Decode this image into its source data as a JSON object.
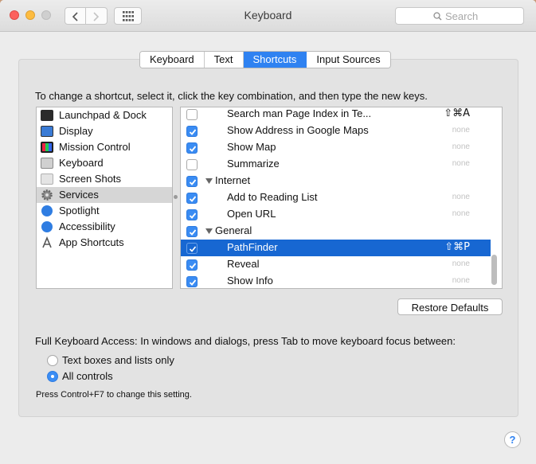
{
  "window": {
    "title": "Keyboard",
    "search_placeholder": "Search"
  },
  "tabs": [
    {
      "label": "Keyboard",
      "active": false
    },
    {
      "label": "Text",
      "active": false
    },
    {
      "label": "Shortcuts",
      "active": true
    },
    {
      "label": "Input Sources",
      "active": false
    }
  ],
  "instructions": "To change a shortcut, select it, click the key combination, and then type the new keys.",
  "categories": [
    {
      "label": "Launchpad & Dock",
      "icon": "launchpad-icon",
      "color": "#2b2b2b"
    },
    {
      "label": "Display",
      "icon": "display-icon",
      "color": "#3a7bd5"
    },
    {
      "label": "Mission Control",
      "icon": "mission-control-icon",
      "color": "#1f1f1f"
    },
    {
      "label": "Keyboard",
      "icon": "keyboard-icon",
      "color": "#8a8a8a"
    },
    {
      "label": "Screen Shots",
      "icon": "screenshot-icon",
      "color": "#b0b0b0"
    },
    {
      "label": "Services",
      "icon": "gear-icon",
      "color": "#7a7a7a",
      "selected": true
    },
    {
      "label": "Spotlight",
      "icon": "spotlight-icon",
      "color": "#2f7de2"
    },
    {
      "label": "Accessibility",
      "icon": "accessibility-icon",
      "color": "#2f7de2"
    },
    {
      "label": "App Shortcuts",
      "icon": "app-shortcuts-icon",
      "color": "#555555"
    }
  ],
  "shortcuts": [
    {
      "type": "item",
      "label": "Search man Page Index in Te...",
      "checked": false,
      "key": "⇧⌘A"
    },
    {
      "type": "item",
      "label": "Show Address in Google Maps",
      "checked": true,
      "key": "none"
    },
    {
      "type": "item",
      "label": "Show Map",
      "checked": true,
      "key": "none"
    },
    {
      "type": "item",
      "label": "Summarize",
      "checked": false,
      "key": "none"
    },
    {
      "type": "group",
      "label": "Internet",
      "checked": true
    },
    {
      "type": "item",
      "label": "Add to Reading List",
      "checked": true,
      "key": "none"
    },
    {
      "type": "item",
      "label": "Open URL",
      "checked": true,
      "key": "none"
    },
    {
      "type": "group",
      "label": "General",
      "checked": true
    },
    {
      "type": "item",
      "label": "PathFinder",
      "checked": true,
      "key": "⇧⌘P",
      "selected": true
    },
    {
      "type": "item",
      "label": "Reveal",
      "checked": true,
      "key": "none"
    },
    {
      "type": "item",
      "label": "Show Info",
      "checked": true,
      "key": "none"
    }
  ],
  "restore_label": "Restore Defaults",
  "full_keyboard_access": "Full Keyboard Access: In windows and dialogs, press Tab to move keyboard focus between:",
  "radio_options": [
    {
      "label": "Text boxes and lists only",
      "selected": false
    },
    {
      "label": "All controls",
      "selected": true
    }
  ],
  "note": "Press Control+F7 to change this setting.",
  "help_label": "?",
  "colors": {
    "accent": "#2f82f1",
    "selection": "#1767d2",
    "close": "#fc615d",
    "minimize": "#fdbc40"
  }
}
